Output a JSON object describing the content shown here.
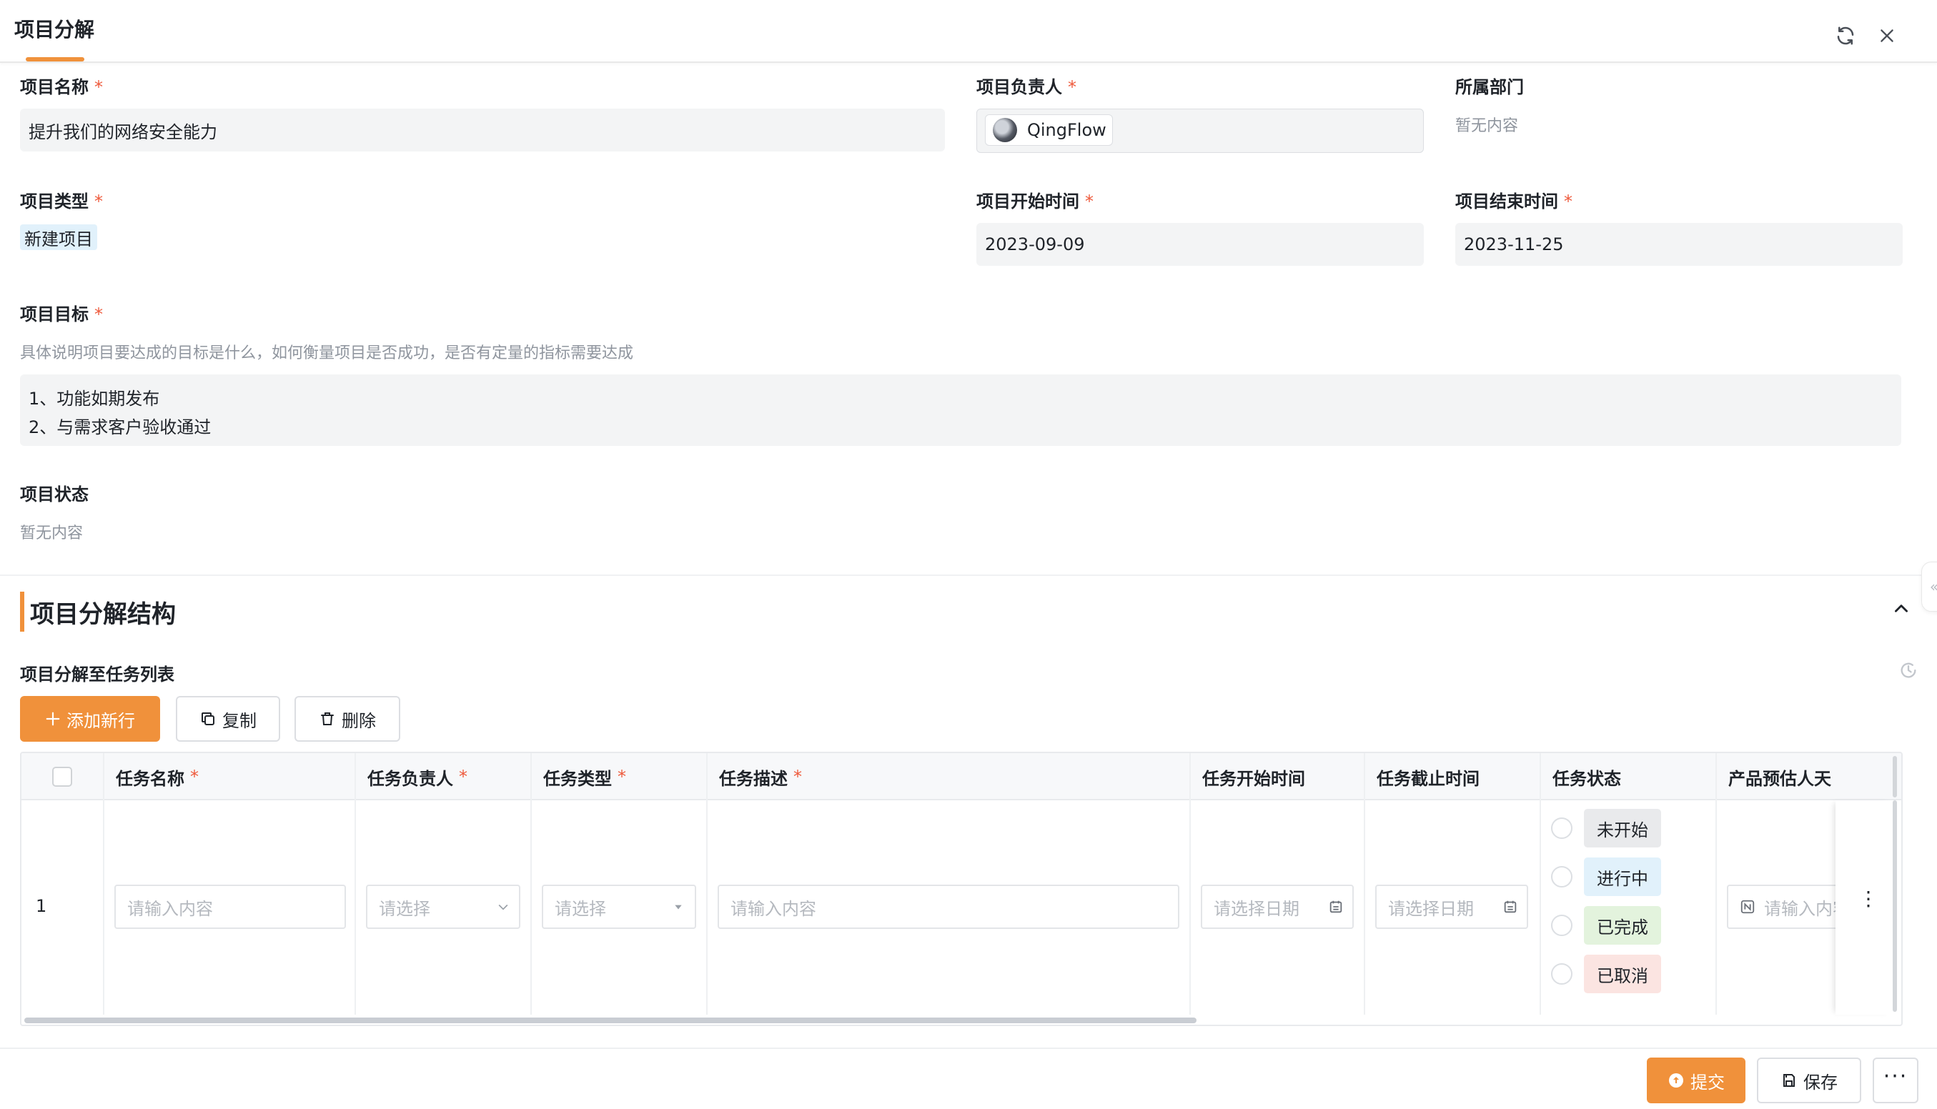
{
  "header": {
    "title": "项目分解"
  },
  "fields": {
    "project_name": {
      "label": "项目名称",
      "value": "提升我们的网络安全能力",
      "required": "*"
    },
    "owner": {
      "label": "项目负责人",
      "value": "QingFlow",
      "required": "*"
    },
    "department": {
      "label": "所属部门",
      "value": "暂无内容"
    },
    "type": {
      "label": "项目类型",
      "value": "新建项目",
      "required": "*"
    },
    "start_time": {
      "label": "项目开始时间",
      "value": "2023-09-09",
      "required": "*"
    },
    "end_time": {
      "label": "项目结束时间",
      "value": "2023-11-25",
      "required": "*"
    },
    "goal": {
      "label": "项目目标",
      "required": "*",
      "hint": "具体说明项目要达成的目标是什么，如何衡量项目是否成功，是否有定量的指标需要达成",
      "lines": [
        "1、功能如期发布",
        "2、与需求客户验收通过"
      ]
    },
    "status": {
      "label": "项目状态",
      "value": "暂无内容"
    }
  },
  "section": {
    "title": "项目分解结构",
    "subtable_label": "项目分解至任务列表",
    "toolbar": {
      "add_label": "添加新行",
      "copy_label": "复制",
      "delete_label": "删除"
    }
  },
  "table": {
    "columns": [
      {
        "label": "任务名称",
        "required": "*"
      },
      {
        "label": "任务负责人",
        "required": "*"
      },
      {
        "label": "任务类型",
        "required": "*"
      },
      {
        "label": "任务描述",
        "required": "*"
      },
      {
        "label": "任务开始时间"
      },
      {
        "label": "任务截止时间"
      },
      {
        "label": "任务状态"
      },
      {
        "label": "产品预估人天"
      }
    ],
    "row": {
      "index": "1",
      "name_placeholder": "请输入内容",
      "owner_placeholder": "请选择",
      "type_placeholder": "请选择",
      "desc_placeholder": "请输入内容",
      "start_placeholder": "请选择日期",
      "end_placeholder": "请选择日期",
      "estimate_placeholder": "请输入内容"
    },
    "status_options": [
      {
        "label": "未开始",
        "color": "#e9eaec"
      },
      {
        "label": "进行中",
        "color": "#e1f1fb"
      },
      {
        "label": "已完成",
        "color": "#e3f3dd"
      },
      {
        "label": "已取消",
        "color": "#fbe4e1"
      }
    ]
  },
  "footer": {
    "submit_label": "提交",
    "save_label": "保存"
  },
  "colors": {
    "accent": "#f0913b",
    "required": "#ee5a3c"
  }
}
